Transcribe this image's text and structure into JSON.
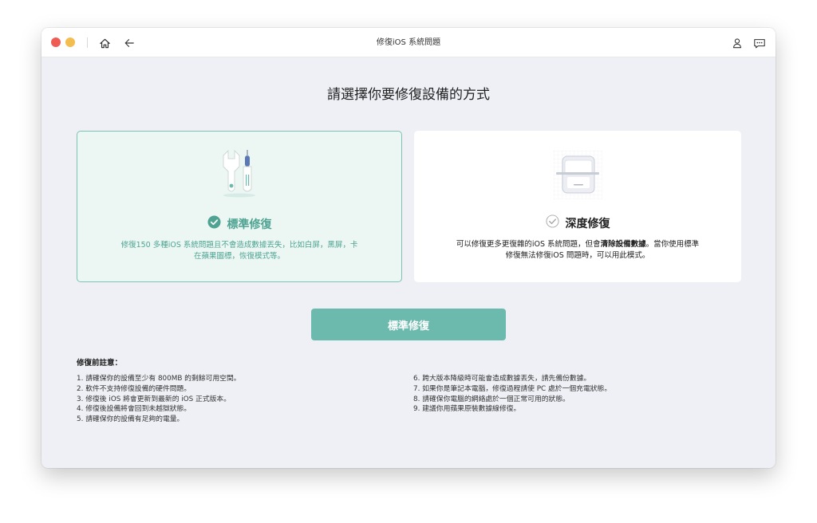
{
  "window": {
    "title": "修復iOS 系統問題"
  },
  "titlebar": {
    "icons": [
      "home-icon",
      "back-arrow-icon",
      "user-icon",
      "chat-icon"
    ]
  },
  "colors": {
    "accent": "#6cb9ad",
    "accent_text": "#4fa392",
    "card_selected_bg": "#ecf7f4"
  },
  "main": {
    "heading": "請選擇你要修復設備的方式",
    "standard": {
      "title": "標準修復",
      "desc": "修復150 多種iOS 系統問題且不會造成數據丟失，比如白屏，黑屏，卡在蘋果圖標，恢復模式等。",
      "selected": true
    },
    "deep": {
      "title": "深度修復",
      "desc_pre": "可以修復更多更復雜的iOS 系統問題，但會",
      "desc_bold": "清除設備數據",
      "desc_post": "。當你使用標準修復無法修復iOS 問題時，可以用此模式。",
      "selected": false
    },
    "button": "標準修復"
  },
  "notes": {
    "title": "修復前註意：",
    "left": [
      "1. 請確保你的設備至少有 800MB 的剩餘可用空間。",
      "2. 軟件不支持修復設備的硬件問題。",
      "3. 修復後 iOS 將會更新到最新的 iOS 正式版本。",
      "4. 修復後設備將會回到未越獄狀態。",
      "5. 請確保你的設備有足夠的電量。"
    ],
    "right": [
      "6. 跨大版本降級時可能會造成數據丟失，請先備份數據。",
      "7. 如果你是筆記本電腦，修復過程請使 PC 處於一個充電狀態。",
      "8. 請確保你電腦的網絡處於一個正常可用的狀態。",
      "9. 建議你用蘋果原裝數據線修復。"
    ]
  }
}
